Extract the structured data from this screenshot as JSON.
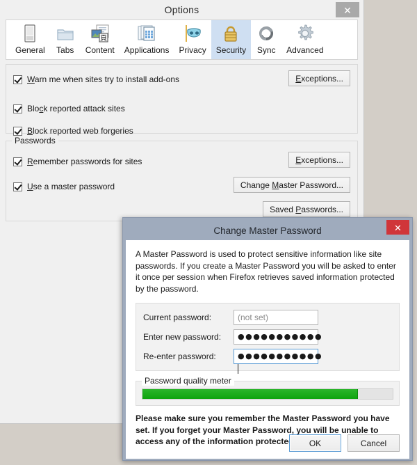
{
  "desktop": {
    "bg_color": "#d3cec7"
  },
  "options_window": {
    "title": "Options",
    "close_label": "✕",
    "tabs": [
      {
        "label": "General",
        "icon": "general-device-icon",
        "selected": false
      },
      {
        "label": "Tabs",
        "icon": "folder-tabs-icon",
        "selected": false
      },
      {
        "label": "Content",
        "icon": "content-page-icon",
        "selected": false
      },
      {
        "label": "Applications",
        "icon": "applications-grid-icon",
        "selected": false
      },
      {
        "label": "Privacy",
        "icon": "privacy-mask-icon",
        "selected": false
      },
      {
        "label": "Security",
        "icon": "security-padlock-icon",
        "selected": true
      },
      {
        "label": "Sync",
        "icon": "sync-arrows-icon",
        "selected": false
      },
      {
        "label": "Advanced",
        "icon": "advanced-gear-icon",
        "selected": false
      }
    ],
    "security_panel": {
      "warnings_group": {
        "options": [
          {
            "label_pre": "",
            "accel": "W",
            "label_post": "arn me when sites try to install add-ons",
            "checked": true
          },
          {
            "label_pre": "Blo",
            "accel": "c",
            "label_post": "k reported attack sites",
            "checked": true
          },
          {
            "label_pre": "",
            "accel": "B",
            "label_post": "lock reported web forgeries",
            "checked": true
          }
        ],
        "exceptions_button": {
          "pre": "",
          "accel": "E",
          "post": "xceptions..."
        }
      },
      "passwords_group": {
        "title": "Passwords",
        "options": [
          {
            "label_pre": "",
            "accel": "R",
            "label_post": "emember passwords for sites",
            "checked": true
          },
          {
            "label_pre": "",
            "accel": "U",
            "label_post": "se a master password",
            "checked": true
          }
        ],
        "exceptions_button": {
          "pre": "",
          "accel": "E",
          "post": "xceptions..."
        },
        "change_master_button": {
          "pre": "Change ",
          "accel": "M",
          "post": "aster Password..."
        },
        "saved_passwords_button": {
          "pre": "Saved ",
          "accel": "P",
          "post": "asswords..."
        }
      }
    }
  },
  "change_master_password_dialog": {
    "title": "Change Master Password",
    "close_label": "✕",
    "close_color": "#d0353a",
    "titlebar_color": "#9fabbd",
    "intro_text": "A Master Password is used to protect sensitive information like site passwords. If you create a Master Password you will be asked to enter it once per session when Firefox retrieves saved information protected by the password.",
    "fields": [
      {
        "label": "Current password:",
        "value": "(not set)",
        "is_placeholder": true,
        "masked": false,
        "focused": false
      },
      {
        "label": "Enter new password:",
        "value": "●●●●●●●●●●●",
        "is_placeholder": false,
        "masked": true,
        "focused": false
      },
      {
        "label": "Re-enter password:",
        "value": "●●●●●●●●●●●",
        "is_placeholder": false,
        "masked": true,
        "focused": true
      }
    ],
    "quality_meter": {
      "title": "Password quality meter",
      "percent": 86,
      "percent_css": "86%",
      "fill_color": "#17a817"
    },
    "warning_text": "Please make sure you remember the Master Password you have set. If you forget your Master Password, you will be unable to access any of the information protected by it.",
    "buttons": {
      "ok": "OK",
      "cancel": "Cancel",
      "default": "ok"
    }
  }
}
